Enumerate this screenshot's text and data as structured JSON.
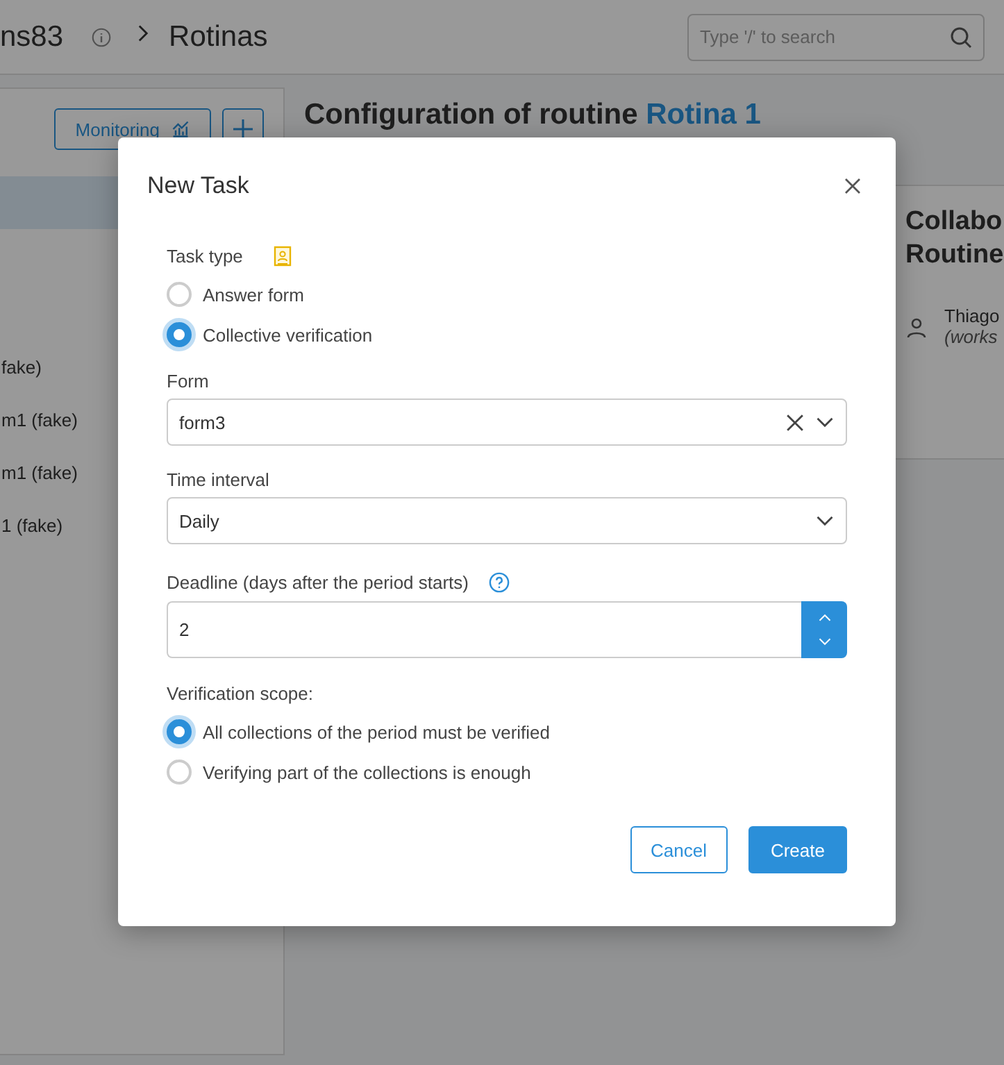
{
  "header": {
    "breadcrumb": [
      "ns83",
      "Rotinas"
    ],
    "search": {
      "placeholder": "Type '/' to search"
    }
  },
  "sidebar": {
    "monitoring_button": "Monitoring",
    "items": [
      "fake)",
      "m1 (fake)",
      "m1 (fake)",
      "1 (fake)"
    ]
  },
  "main": {
    "title": "Configuration of routine",
    "title_link": "Rotina 1"
  },
  "card": {
    "title_lines": [
      "Collabo",
      "Routine"
    ],
    "user": "Thiago",
    "user_note": "(works"
  },
  "dialog": {
    "title": "New Task",
    "task_type": {
      "label": "Task type",
      "options": [
        {
          "label": "Answer form",
          "selected": false
        },
        {
          "label": "Collective verification",
          "selected": true
        }
      ]
    },
    "form": {
      "label": "Form",
      "value": "form3"
    },
    "interval": {
      "label": "Time interval",
      "value": "Daily"
    },
    "deadline": {
      "label": "Deadline (days after the period starts)",
      "value": "2"
    },
    "scope": {
      "label": "Verification scope:",
      "options": [
        {
          "label": "All collections of the period must be verified",
          "selected": true
        },
        {
          "label": "Verifying part of the collections is enough",
          "selected": false
        }
      ]
    },
    "buttons": [
      {
        "label": "Cancel",
        "kind": "secondary"
      },
      {
        "label": "Create",
        "kind": "primary"
      }
    ]
  }
}
